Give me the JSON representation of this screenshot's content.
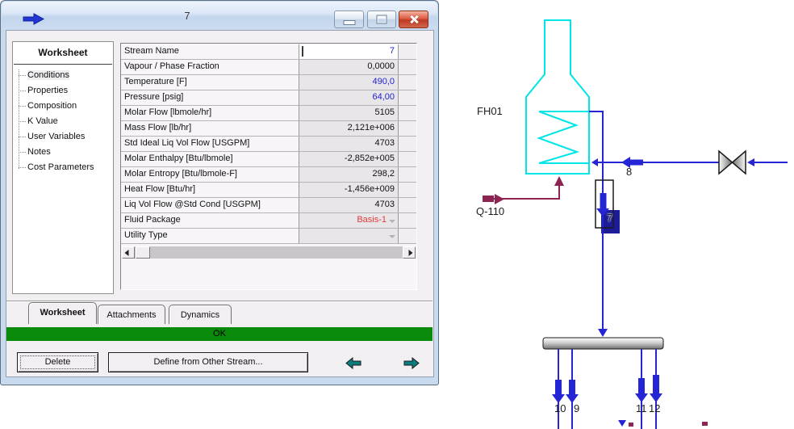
{
  "colors": {
    "stream_blue": "#2525d6",
    "heater_cyan": "#00e6e6",
    "energy_maroon": "#8e2453",
    "selection_navy": "#1c1c99",
    "status_green": "#0a8a0a",
    "nav_teal": "#0b7d7d",
    "value_blue": "#2222cc",
    "value_red": "#e03a3a"
  },
  "window": {
    "title": "7",
    "titlebar_icon": "blue-right-arrow"
  },
  "sidebar": {
    "header": "Worksheet",
    "selected_item": "Conditions",
    "items": [
      "Conditions",
      "Properties",
      "Composition",
      "K Value",
      "User Variables",
      "Notes",
      "Cost Parameters"
    ]
  },
  "worksheet": {
    "rows": [
      {
        "label": "Stream Name",
        "value": "7",
        "color": "blue",
        "editing": true
      },
      {
        "label": "Vapour / Phase Fraction",
        "value": "0,0000",
        "color": "black"
      },
      {
        "label": "Temperature [F]",
        "value": "490,0",
        "color": "blue"
      },
      {
        "label": "Pressure [psig]",
        "value": "64,00",
        "color": "blue"
      },
      {
        "label": "Molar Flow [lbmole/hr]",
        "value": "5105",
        "color": "black"
      },
      {
        "label": "Mass Flow [lb/hr]",
        "value": "2,121e+006",
        "color": "black"
      },
      {
        "label": "Std Ideal Liq Vol Flow [USGPM]",
        "value": "4703",
        "color": "black"
      },
      {
        "label": "Molar Enthalpy [Btu/lbmole]",
        "value": "-2,852e+005",
        "color": "black"
      },
      {
        "label": "Molar Entropy [Btu/lbmole-F]",
        "value": "298,2",
        "color": "black"
      },
      {
        "label": "Heat Flow [Btu/hr]",
        "value": "-1,456e+009",
        "color": "black"
      },
      {
        "label": "Liq Vol Flow @Std Cond [USGPM]",
        "value": "4703",
        "color": "black"
      },
      {
        "label": "Fluid Package",
        "value": "Basis-1",
        "color": "red",
        "dropdown": true
      },
      {
        "label": "Utility Type",
        "value": "",
        "color": "black",
        "dropdown": true
      }
    ]
  },
  "tabs": [
    {
      "label": "Worksheet",
      "active": true
    },
    {
      "label": "Attachments",
      "active": false
    },
    {
      "label": "Dynamics",
      "active": false
    }
  ],
  "status": {
    "text": "OK"
  },
  "actions": {
    "delete": "Delete",
    "define": "Define from Other Stream..."
  },
  "pfd": {
    "heater_tag": "FH01",
    "energy_stream": "Q-110",
    "stream_labels": {
      "s7": "7",
      "s8": "8",
      "s9": "9",
      "s10": "10",
      "s11": "11",
      "s12": "12"
    }
  }
}
